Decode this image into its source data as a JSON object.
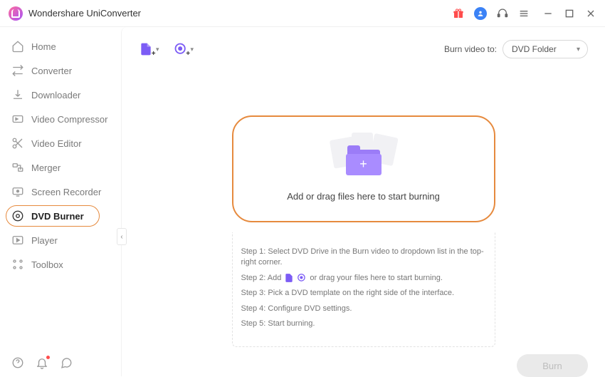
{
  "app": {
    "title": "Wondershare UniConverter"
  },
  "sidebar": {
    "items": [
      {
        "label": "Home"
      },
      {
        "label": "Converter"
      },
      {
        "label": "Downloader"
      },
      {
        "label": "Video Compressor"
      },
      {
        "label": "Video Editor"
      },
      {
        "label": "Merger"
      },
      {
        "label": "Screen Recorder"
      },
      {
        "label": "DVD Burner"
      },
      {
        "label": "Player"
      },
      {
        "label": "Toolbox"
      }
    ],
    "active_index": 7
  },
  "toolbar": {
    "burn_video_to_label": "Burn video to:",
    "burn_video_to_value": "DVD Folder"
  },
  "dropzone": {
    "text": "Add or drag files here to start burning"
  },
  "steps": {
    "s1a": "Step 1: Select DVD Drive in the Burn video to dropdown list in the top-right corner.",
    "s2a": "Step 2: Add",
    "s2b": "or drag your files here to start burning.",
    "s3": "Step 3: Pick a DVD template on the right side of the interface.",
    "s4": "Step 4: Configure DVD settings.",
    "s5": "Step 5: Start burning."
  },
  "footer": {
    "burn_label": "Burn"
  }
}
